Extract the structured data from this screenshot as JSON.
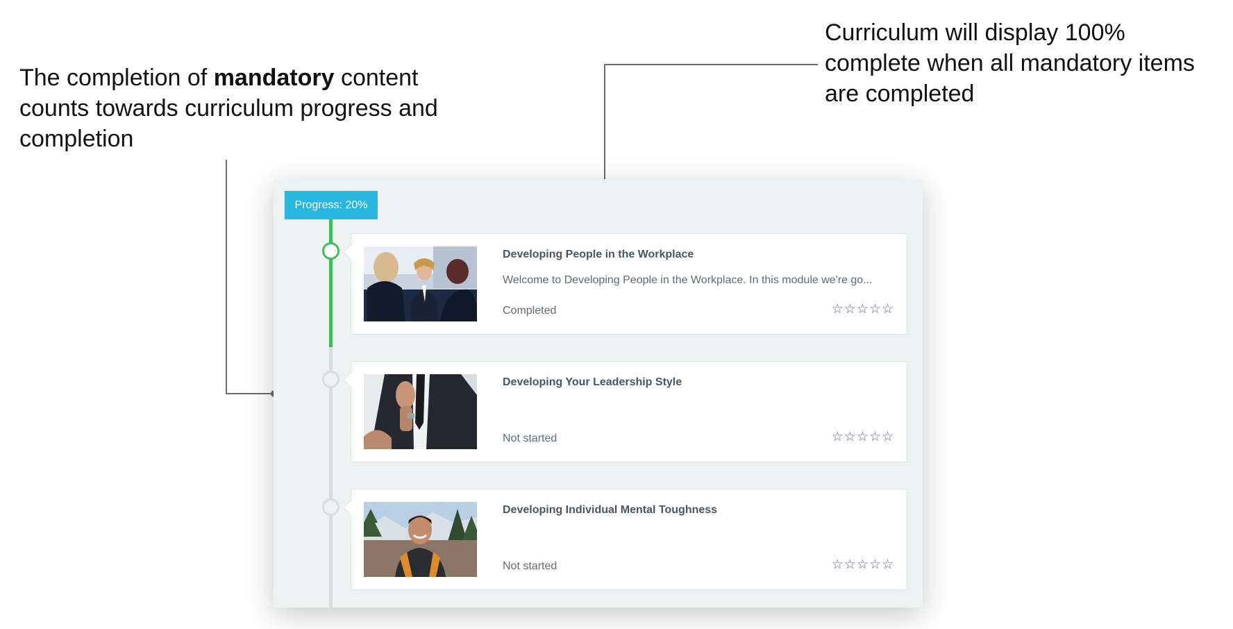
{
  "annotations": {
    "left_pre": "The completion of ",
    "left_bold": "mandatory",
    "left_post": " content counts towards curriculum progress and completion",
    "right": "Curriculum will display 100% complete when all mandatory items are completed"
  },
  "progress": {
    "label": "Progress: 20%",
    "value_percent": 20
  },
  "colors": {
    "progress_pill": "#29b7e2",
    "completed_track": "#3cbf5a",
    "pending_track": "#d7dcdc",
    "star": "#6c5aa8"
  },
  "modules": [
    {
      "title": "Developing People in the Workplace",
      "description": "Welcome to Developing People in the Workplace. In this module we're go...",
      "status": "Completed",
      "completed": true,
      "rating": 0,
      "thumbnail_icon": "business-meeting-photo"
    },
    {
      "title": "Developing Your Leadership Style",
      "description": "",
      "status": "Not started",
      "completed": false,
      "rating": 0,
      "thumbnail_icon": "businessman-tie-photo"
    },
    {
      "title": "Developing Individual Mental Toughness",
      "description": "",
      "status": "Not started",
      "completed": false,
      "rating": 0,
      "thumbnail_icon": "hiker-portrait-photo"
    }
  ],
  "star_glyph": "☆",
  "star_count_max": 5
}
